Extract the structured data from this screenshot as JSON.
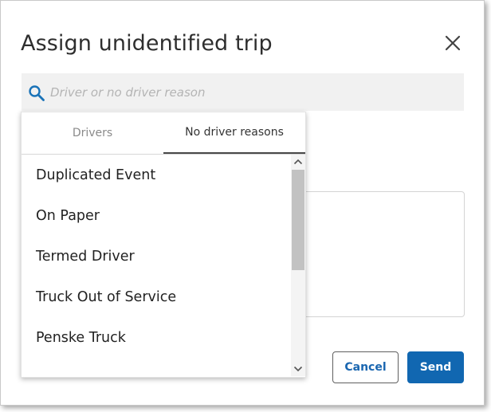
{
  "dialog": {
    "title": "Assign unidentified trip",
    "close_icon": "close-icon"
  },
  "search": {
    "icon": "search-icon",
    "placeholder": "Driver or no driver reason",
    "value": ""
  },
  "dropdown": {
    "tabs": [
      {
        "label": "Drivers",
        "active": false
      },
      {
        "label": "No driver reasons",
        "active": true
      }
    ],
    "items": [
      {
        "label": "Duplicated Event"
      },
      {
        "label": "On Paper"
      },
      {
        "label": "Termed Driver"
      },
      {
        "label": "Truck Out of Service"
      },
      {
        "label": "Penske Truck"
      }
    ],
    "scroll_position": 0
  },
  "actions": {
    "cancel_label": "Cancel",
    "send_label": "Send"
  },
  "colors": {
    "accent": "#1167b1",
    "search_icon": "#1a73b8",
    "title_text": "#2e2e2e"
  }
}
